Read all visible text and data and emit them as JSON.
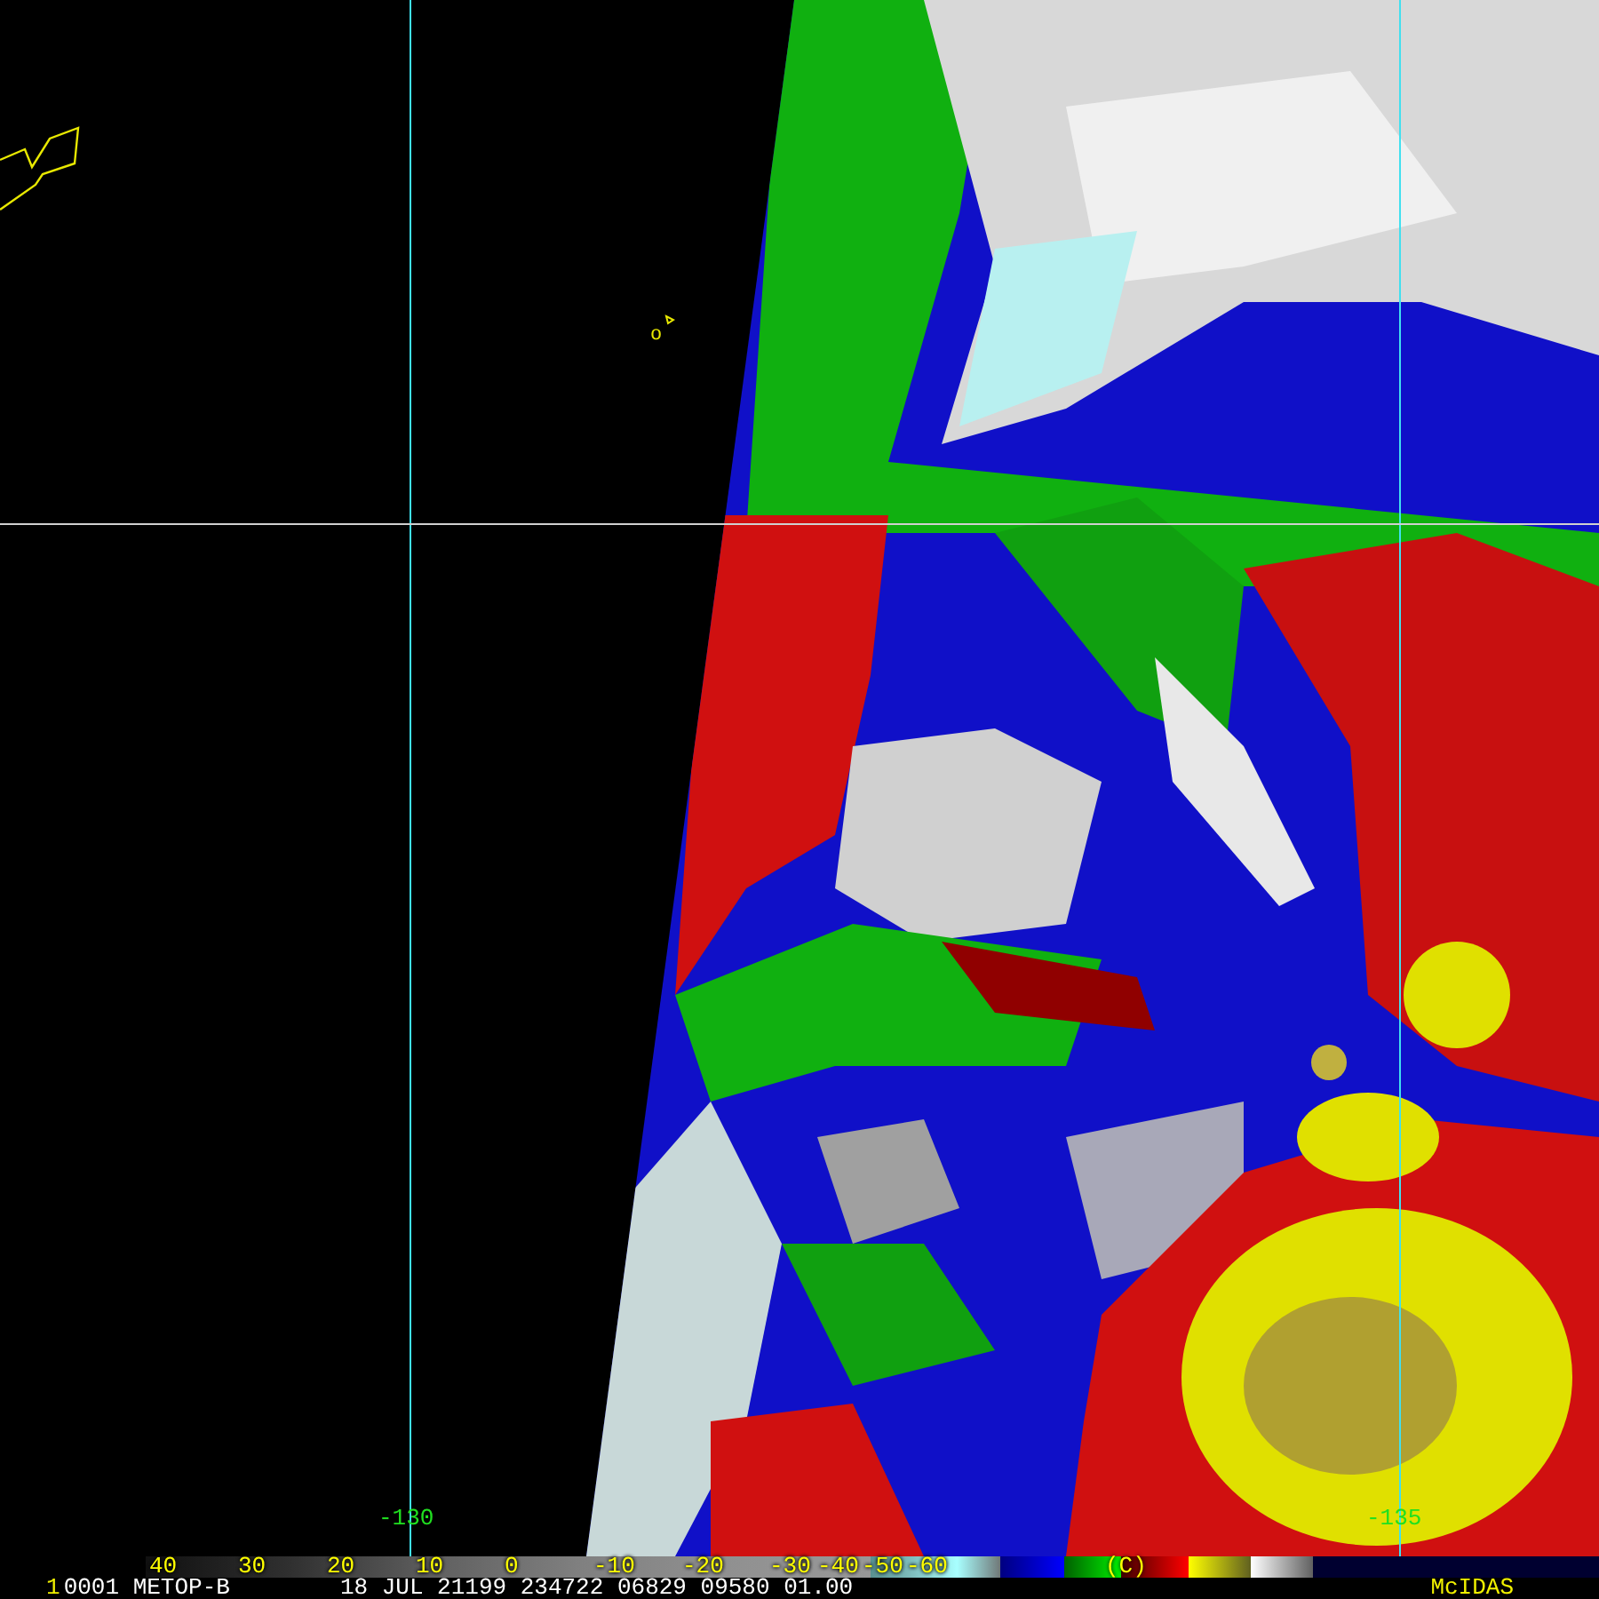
{
  "map": {
    "grid_labels": [
      {
        "text": "-130"
      },
      {
        "text": "-135"
      }
    ],
    "island_label": "o"
  },
  "color_bar": {
    "labels": [
      "40",
      "30",
      "20",
      "10",
      "0",
      "-10",
      "-20",
      "-30",
      "-40",
      "-50",
      "-60"
    ],
    "unit": "(C)"
  },
  "status_bar": {
    "frame": "1",
    "info": "0001 METOP-B",
    "datetime": "18 JUL 21199 234722 06829 09580 01.00",
    "brand": "McIDAS"
  }
}
